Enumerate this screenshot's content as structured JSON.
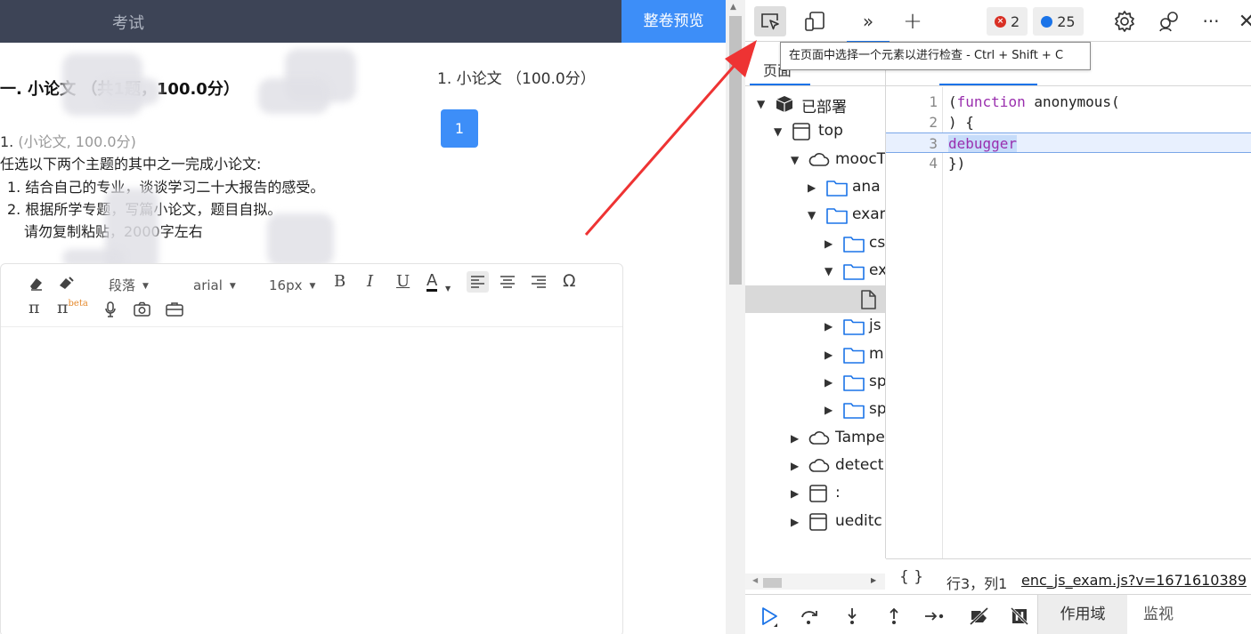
{
  "exam": {
    "header_title": "考试",
    "preview_button": "整卷预览",
    "section_title": "一. 小论文 （共1题，100.0分）",
    "nav_title": "1. 小论文 （100.0分）",
    "nav_question_number": "1",
    "question": {
      "number": "1.",
      "meta": "(小论文, 100.0分)",
      "prompt": "任选以下两个主题的其中之一完成小论文:",
      "items": [
        "1. 结合自己的专业，谈谈学习二十大报告的感受。",
        "2. 根据所学专题，写篇小论文，题目自拟。"
      ],
      "note": "请勿复制粘贴，2000字左右"
    },
    "editor_toolbar": {
      "paragraph_select": "段落",
      "font_select": "arial",
      "size_select": "16px",
      "bold": "B",
      "italic": "I",
      "underline": "U",
      "font_color": "A",
      "omega": "Ω",
      "pi": "π",
      "pi_beta": "π",
      "beta_label": "beta"
    }
  },
  "devtools": {
    "toolbar": {
      "more_tabs": "»",
      "add_tab": "+",
      "error_count": "2",
      "message_count": "25",
      "kebab": "···",
      "close": "✕"
    },
    "tooltip": "在页面中选择一个元素以进行检查 - Ctrl + Shift + C",
    "sources_tab_page": "页面",
    "file_tree": [
      {
        "label": "已部署",
        "twisty": "▼",
        "icon": "box-icon",
        "indent": 0
      },
      {
        "label": "top",
        "twisty": "▼",
        "icon": "frame-icon",
        "indent": 1
      },
      {
        "label": "moocT",
        "twisty": "▼",
        "icon": "cloud-icon",
        "indent": 2
      },
      {
        "label": "ana",
        "twisty": "▶",
        "icon": "folder-icon",
        "indent": 3
      },
      {
        "label": "exam",
        "twisty": "▼",
        "icon": "folder-icon",
        "indent": 3
      },
      {
        "label": "cs",
        "twisty": "▶",
        "icon": "folder-icon",
        "indent": 4
      },
      {
        "label": "ex",
        "twisty": "▼",
        "icon": "folder-icon",
        "indent": 4
      },
      {
        "label": "",
        "twisty": "",
        "icon": "file-icon",
        "indent": 5,
        "selected": true
      },
      {
        "label": "js",
        "twisty": "▶",
        "icon": "folder-icon",
        "indent": 4
      },
      {
        "label": "m",
        "twisty": "▶",
        "icon": "folder-icon",
        "indent": 4
      },
      {
        "label": "sp",
        "twisty": "▶",
        "icon": "folder-icon",
        "indent": 4
      },
      {
        "label": "sp",
        "twisty": "▶",
        "icon": "folder-icon",
        "indent": 4
      },
      {
        "label": "Tamper",
        "twisty": "▶",
        "icon": "cloud-icon",
        "indent": 2
      },
      {
        "label": "detect",
        "twisty": "▶",
        "icon": "cloud-icon",
        "indent": 2
      },
      {
        "label": ":",
        "twisty": "▶",
        "icon": "frame-icon",
        "indent": 2
      },
      {
        "label": "ueditc",
        "twisty": "▶",
        "icon": "frame-icon",
        "indent": 2
      }
    ],
    "code_lines": [
      {
        "n": "1",
        "text": "(function anonymous(",
        "kw": "function"
      },
      {
        "n": "2",
        "text": ") {"
      },
      {
        "n": "3",
        "text": "debugger",
        "debugger": true
      },
      {
        "n": "4",
        "text": "})"
      }
    ],
    "status": {
      "pretty_print": "{ }",
      "cursor": "行3，列1",
      "source_link": "enc_js_exam.js?v=1671610389"
    },
    "debug_tabs": {
      "scope": "作用域",
      "watch": "监视"
    }
  }
}
